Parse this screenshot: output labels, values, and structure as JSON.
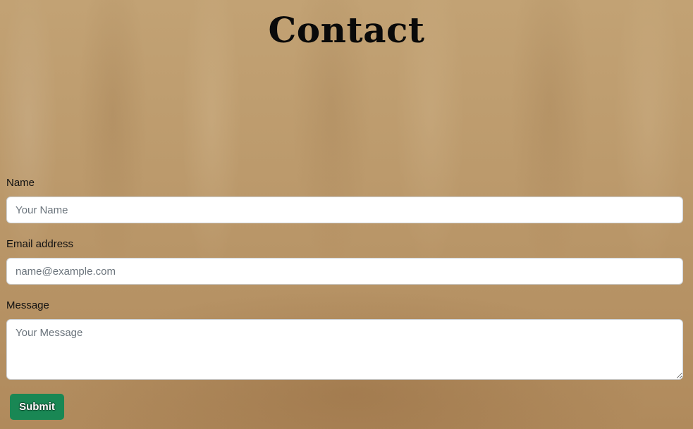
{
  "page": {
    "title": "Contact"
  },
  "form": {
    "name": {
      "label": "Name",
      "placeholder": "Your Name",
      "value": ""
    },
    "email": {
      "label": "Email address",
      "placeholder": "name@example.com",
      "value": ""
    },
    "message": {
      "label": "Message",
      "placeholder": "Your Message",
      "value": ""
    },
    "submit_label": "Submit"
  },
  "colors": {
    "submit_button": "#198754",
    "background": "#b89468"
  }
}
